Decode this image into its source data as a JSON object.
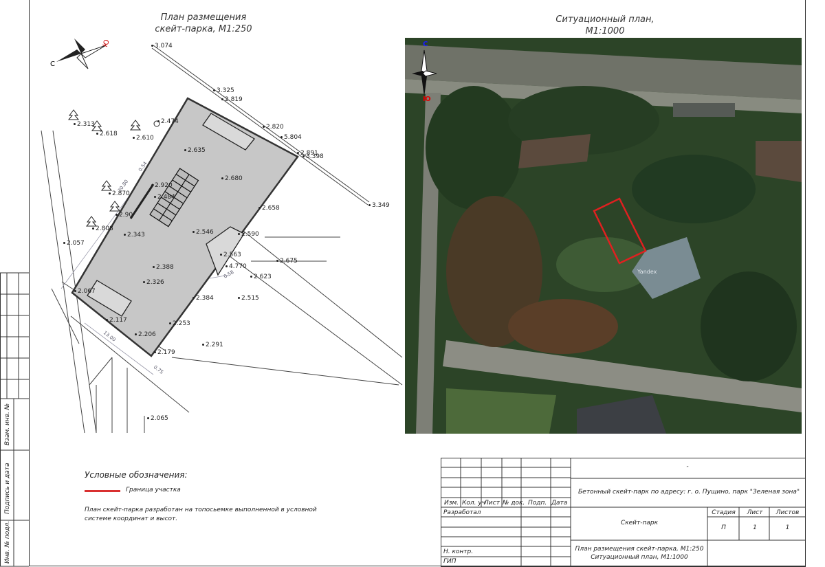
{
  "site_plan": {
    "title_line1": "План размещения",
    "title_line2": "скейт-парка, М1:250",
    "compass": {
      "north": "С",
      "south": "Ю"
    },
    "elevations": [
      {
        "id": "e1",
        "text": "3.074"
      },
      {
        "id": "e2",
        "text": "3.325"
      },
      {
        "id": "e3",
        "text": "2.819"
      },
      {
        "id": "e4",
        "text": "2.474"
      },
      {
        "id": "e5",
        "text": "2.313"
      },
      {
        "id": "e6",
        "text": "2.618"
      },
      {
        "id": "e7",
        "text": "2.610"
      },
      {
        "id": "e8",
        "text": "2.820"
      },
      {
        "id": "e9",
        "text": "5.804"
      },
      {
        "id": "e10",
        "text": "2.635"
      },
      {
        "id": "e11",
        "text": "2.891"
      },
      {
        "id": "e12",
        "text": "3.398"
      },
      {
        "id": "e13",
        "text": "2.680"
      },
      {
        "id": "e14",
        "text": "2.870"
      },
      {
        "id": "e15",
        "text": "2.920"
      },
      {
        "id": "e16",
        "text": "2.484"
      },
      {
        "id": "e17",
        "text": "2.658"
      },
      {
        "id": "e18",
        "text": "3.349"
      },
      {
        "id": "e19",
        "text": "2.90"
      },
      {
        "id": "e20",
        "text": "2.808"
      },
      {
        "id": "e21",
        "text": "2.343"
      },
      {
        "id": "e22",
        "text": "2.546"
      },
      {
        "id": "e23",
        "text": "2.590"
      },
      {
        "id": "e24",
        "text": "2.057"
      },
      {
        "id": "e25",
        "text": "2.563"
      },
      {
        "id": "e26",
        "text": "4.770"
      },
      {
        "id": "e27",
        "text": "2.675"
      },
      {
        "id": "e28",
        "text": "2.388"
      },
      {
        "id": "e29",
        "text": "2.623"
      },
      {
        "id": "e30",
        "text": "2.326"
      },
      {
        "id": "e31",
        "text": "2.067"
      },
      {
        "id": "e32",
        "text": "2.384"
      },
      {
        "id": "e33",
        "text": "2.515"
      },
      {
        "id": "e34",
        "text": "2.117"
      },
      {
        "id": "e35",
        "text": "2.253"
      },
      {
        "id": "e36",
        "text": "2.206"
      },
      {
        "id": "e37",
        "text": "2.291"
      },
      {
        "id": "e38",
        "text": "2.179"
      },
      {
        "id": "e39",
        "text": "2.065"
      }
    ],
    "dims": {
      "d1": "30.80",
      "d2": "0.54",
      "d3": "13.00",
      "d4": "0.75",
      "d5": "0.58"
    }
  },
  "situation_plan": {
    "title_line1": "Ситуационный план,",
    "title_line2": "М1:1000",
    "compass": {
      "north": "С",
      "south": "Ю"
    },
    "map_watermark": "Yandex"
  },
  "legend": {
    "title": "Условные обозначения:",
    "boundary_label": "Граница участка",
    "note": "План скейт-парка разработан на топосьемке выполненной в условной системе координат и высот.",
    "boundary_color": "#d93030"
  },
  "side_stamp": {
    "cells": [
      "Взам. инв. №",
      "Подпись и дата",
      "Инв. № подл."
    ]
  },
  "title_block": {
    "dash": "-",
    "project": "Бетонный скейт-парк по адресу: г. о. Пущино, парк \"Зеленая зона\"",
    "headers": [
      "Изм.",
      "Кол. уч",
      "Лист",
      "№ док.",
      "Подп.",
      "Дата"
    ],
    "roles": {
      "developed": "Разработал",
      "norm_control": "Н. контр.",
      "chief": "ГИП"
    },
    "object_name": "Скейт-парк",
    "stage_label": "Стадия",
    "sheet_label": "Лист",
    "sheets_label": "Листов",
    "stage_value": "П",
    "sheet_value": "1",
    "sheets_value": "1",
    "drawing_title_line1": "План размещения скейт-парка, М1:250",
    "drawing_title_line2": "Ситуационный план, М1:1000"
  }
}
